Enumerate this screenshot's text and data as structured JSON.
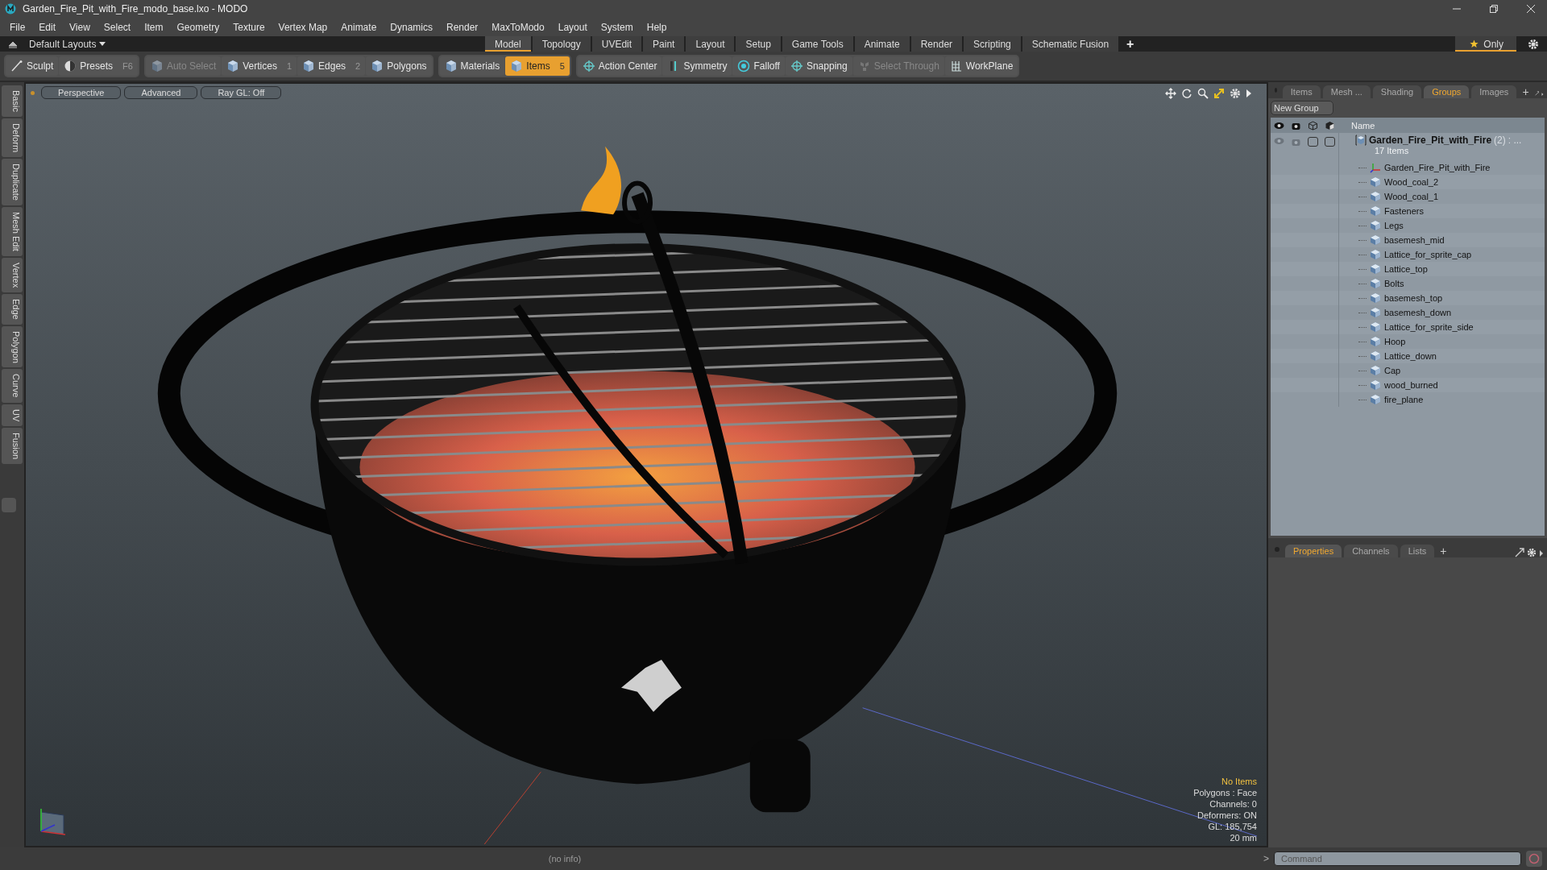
{
  "window": {
    "title": "Garden_Fire_Pit_with_Fire_modo_base.lxo - MODO"
  },
  "menu": [
    "File",
    "Edit",
    "View",
    "Select",
    "Item",
    "Geometry",
    "Texture",
    "Vertex Map",
    "Animate",
    "Dynamics",
    "Render",
    "MaxToModo",
    "Layout",
    "System",
    "Help"
  ],
  "layout_bar": {
    "layouts_label": "Default Layouts",
    "tabs": [
      {
        "label": "Model",
        "selected": true
      },
      {
        "label": "Topology",
        "selected": false
      },
      {
        "label": "UVEdit",
        "selected": false
      },
      {
        "label": "Paint",
        "selected": false
      },
      {
        "label": "Layout",
        "selected": false
      },
      {
        "label": "Setup",
        "selected": false
      },
      {
        "label": "Game Tools",
        "selected": false
      },
      {
        "label": "Animate",
        "selected": false
      },
      {
        "label": "Render",
        "selected": false
      },
      {
        "label": "Scripting",
        "selected": false
      },
      {
        "label": "Schematic Fusion",
        "selected": false
      }
    ],
    "add_label": "+",
    "only_label": "Only"
  },
  "toolbar": {
    "groups": [
      [
        {
          "label": "Sculpt",
          "selected": false,
          "disabled": false
        },
        {
          "label": "Presets",
          "shortcut": "F6",
          "selected": false,
          "disabled": false
        }
      ],
      [
        {
          "label": "Auto Select",
          "selected": false,
          "disabled": true
        },
        {
          "label": "Vertices",
          "shortcut": "1",
          "selected": false,
          "disabled": false
        },
        {
          "label": "Edges",
          "shortcut": "2",
          "selected": false,
          "disabled": false
        },
        {
          "label": "Polygons",
          "selected": false,
          "disabled": false
        }
      ],
      [
        {
          "label": "Materials",
          "selected": false,
          "disabled": false
        },
        {
          "label": "Items",
          "shortcut": "5",
          "selected": true,
          "disabled": false
        }
      ],
      [
        {
          "label": "Action Center",
          "selected": false,
          "disabled": false
        },
        {
          "label": "Symmetry",
          "selected": false,
          "disabled": false
        },
        {
          "label": "Falloff",
          "selected": false,
          "disabled": false
        },
        {
          "label": "Snapping",
          "selected": false,
          "disabled": false
        },
        {
          "label": "Select Through",
          "selected": false,
          "disabled": true
        },
        {
          "label": "WorkPlane",
          "selected": false,
          "disabled": false
        }
      ]
    ]
  },
  "side_tabs": [
    "Basic",
    "Deform",
    "Duplicate",
    "Mesh Edit",
    "Vertex",
    "Edge",
    "Polygon",
    "Curve",
    "UV",
    "Fusion"
  ],
  "viewport": {
    "buttons": [
      "Perspective",
      "Advanced",
      "Ray GL: Off"
    ],
    "info": [
      {
        "text": "No Items",
        "kind": "highlight"
      },
      {
        "text": "Polygons : Face",
        "kind": "normal"
      },
      {
        "text": "Channels: 0",
        "kind": "normal"
      },
      {
        "text": "Deformers: ON",
        "kind": "normal"
      },
      {
        "text": "GL: 185,754",
        "kind": "normal"
      },
      {
        "text": "20 mm",
        "kind": "normal"
      }
    ]
  },
  "status_bar": {
    "text": "(no info)"
  },
  "groups_panel": {
    "tabs": [
      {
        "label": "Items",
        "selected": false
      },
      {
        "label": "Mesh ...",
        "selected": false
      },
      {
        "label": "Shading",
        "selected": false
      },
      {
        "label": "Groups",
        "selected": true
      },
      {
        "label": "Images",
        "selected": false
      }
    ],
    "add_label": "+",
    "new_group_label": "New Group",
    "name_column": "Name",
    "group": {
      "toggles": [
        {
          "checked": false
        },
        {
          "checked": false
        }
      ],
      "name": "Garden_Fire_Pit_with_Fire",
      "count": "(2)",
      "trailing": ": ...",
      "subtitle": "17 Items",
      "children": [
        {
          "name": "Garden_Fire_Pit_with_Fire",
          "kind": "locator"
        },
        {
          "name": "Wood_coal_2",
          "kind": "mesh"
        },
        {
          "name": "Wood_coal_1",
          "kind": "mesh"
        },
        {
          "name": "Fasteners",
          "kind": "mesh"
        },
        {
          "name": "Legs",
          "kind": "mesh"
        },
        {
          "name": "basemesh_mid",
          "kind": "mesh"
        },
        {
          "name": "Lattice_for_sprite_cap",
          "kind": "mesh"
        },
        {
          "name": "Lattice_top",
          "kind": "mesh"
        },
        {
          "name": "Bolts",
          "kind": "mesh"
        },
        {
          "name": "basemesh_top",
          "kind": "mesh"
        },
        {
          "name": "basemesh_down",
          "kind": "mesh"
        },
        {
          "name": "Lattice_for_sprite_side",
          "kind": "mesh"
        },
        {
          "name": "Hoop",
          "kind": "mesh"
        },
        {
          "name": "Lattice_down",
          "kind": "mesh"
        },
        {
          "name": "Cap",
          "kind": "mesh"
        },
        {
          "name": "wood_burned",
          "kind": "mesh"
        },
        {
          "name": "fire_plane",
          "kind": "mesh"
        }
      ]
    }
  },
  "properties_panel": {
    "tabs": [
      {
        "label": "Properties",
        "selected": true
      },
      {
        "label": "Channels",
        "selected": false
      },
      {
        "label": "Lists",
        "selected": false
      }
    ],
    "add_label": "+"
  },
  "command": {
    "prompt": ">",
    "placeholder": "Command"
  }
}
